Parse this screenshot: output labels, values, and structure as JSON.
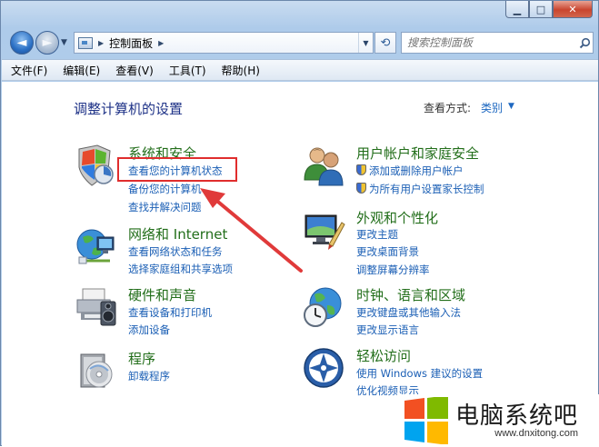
{
  "window": {
    "minimize_glyph": "▁",
    "maximize_glyph": "□",
    "close_glyph": "✕"
  },
  "navigation": {
    "back_glyph": "◄",
    "forward_glyph": "►",
    "history_glyph": "▼",
    "breadcrumb_sep_glyph": "▶",
    "breadcrumb": "控制面板",
    "address_drop_glyph": "▼",
    "refresh_glyph": "⟲",
    "search_placeholder": "搜索控制面板",
    "search_glyph": "⚲"
  },
  "menu": [
    "文件(F)",
    "编辑(E)",
    "查看(V)",
    "工具(T)",
    "帮助(H)"
  ],
  "main": {
    "title": "调整计算机的设置",
    "view_by_label": "查看方式:",
    "view_by_value": "类别",
    "view_by_arrow": "▼"
  },
  "categories": [
    {
      "icon": "system-security-icon",
      "title": "系统和安全",
      "links": [
        "查看您的计算机状态",
        "备份您的计算机",
        "查找并解决问题"
      ]
    },
    {
      "icon": "network-internet-icon",
      "title": "网络和 Internet",
      "links": [
        "查看网络状态和任务",
        "选择家庭组和共享选项"
      ]
    },
    {
      "icon": "hardware-sound-icon",
      "title": "硬件和声音",
      "links": [
        "查看设备和打印机",
        "添加设备"
      ]
    },
    {
      "icon": "programs-icon",
      "title": "程序",
      "links": [
        "卸载程序"
      ]
    },
    {
      "icon": "user-accounts-icon",
      "title": "用户帐户和家庭安全",
      "links": [
        "添加或删除用户帐户",
        "为所有用户设置家长控制"
      ]
    },
    {
      "icon": "appearance-icon",
      "title": "外观和个性化",
      "links": [
        "更改主题",
        "更改桌面背景",
        "调整屏幕分辨率"
      ]
    },
    {
      "icon": "clock-language-icon",
      "title": "时钟、语言和区域",
      "links": [
        "更改键盘或其他输入法",
        "更改显示语言"
      ]
    },
    {
      "icon": "ease-of-access-icon",
      "title": "轻松访问",
      "links": [
        "使用 Windows 建议的设置",
        "优化视频显示"
      ]
    }
  ],
  "watermark": {
    "title": "电脑系统吧",
    "url": "www.dnxitong.com"
  },
  "colors": {
    "category_title": "#226e1a",
    "link": "#1b5fb5",
    "highlight": "#e02d2d"
  }
}
